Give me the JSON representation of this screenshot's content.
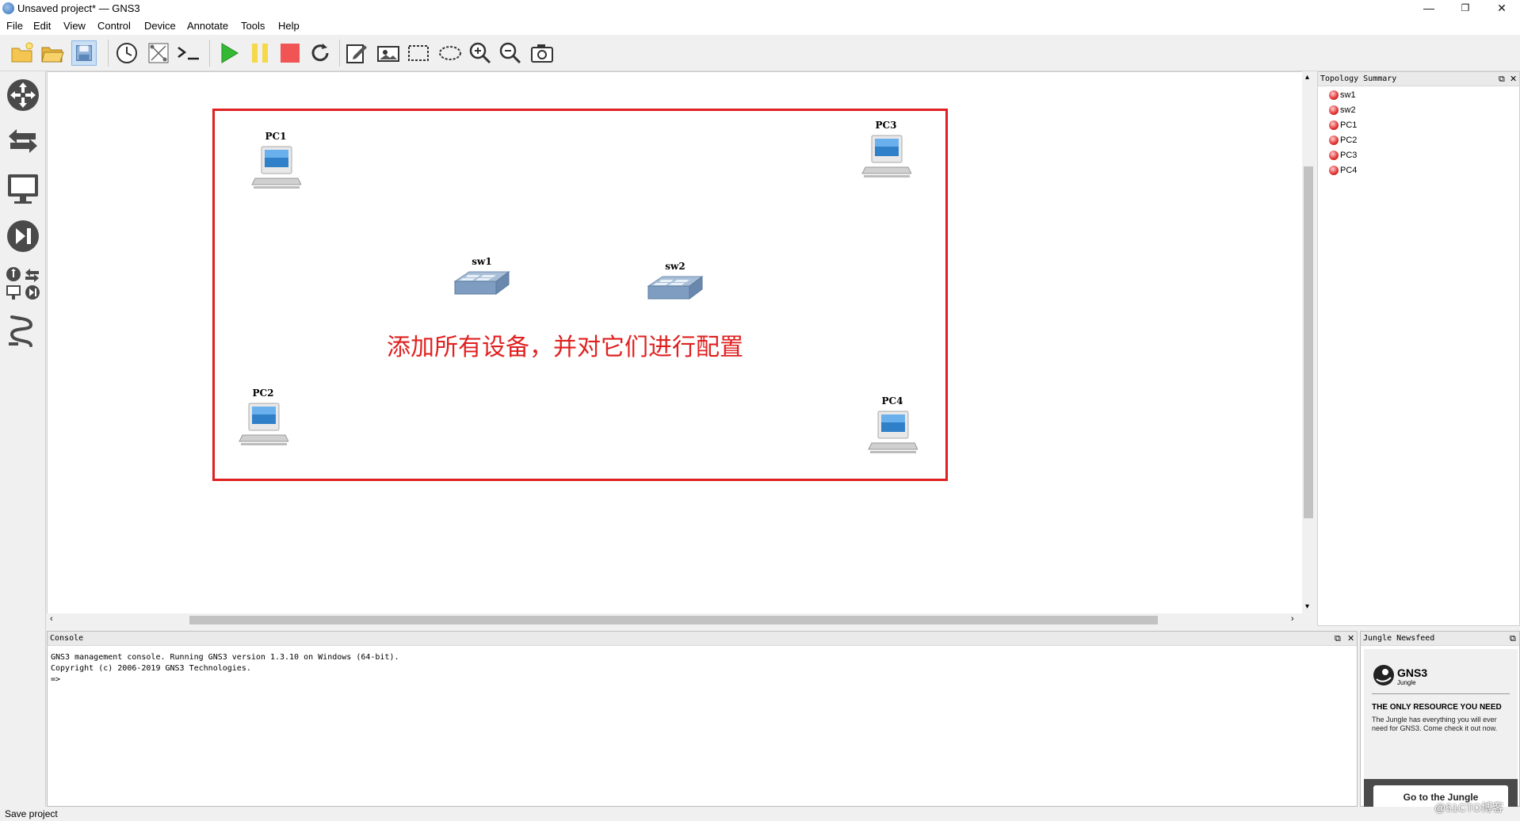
{
  "window": {
    "title": "Unsaved project* — GNS3"
  },
  "menu": [
    "File",
    "Edit",
    "View",
    "Control",
    "Device",
    "Annotate",
    "Tools",
    "Help"
  ],
  "canvas": {
    "devices": [
      {
        "label": "PC1",
        "kind": "pc"
      },
      {
        "label": "PC3",
        "kind": "pc"
      },
      {
        "label": "sw1",
        "kind": "switch"
      },
      {
        "label": "sw2",
        "kind": "switch"
      },
      {
        "label": "PC2",
        "kind": "pc"
      },
      {
        "label": "PC4",
        "kind": "pc"
      }
    ],
    "annotation": "添加所有设备，并对它们进行配置",
    "annotation_color": "#e02020"
  },
  "topology_summary": {
    "title": "Topology Summary",
    "items": [
      "sw1",
      "sw2",
      "PC1",
      "PC2",
      "PC3",
      "PC4"
    ]
  },
  "console": {
    "title": "Console",
    "lines": [
      "GNS3 management console. Running GNS3 version 1.3.10 on Windows (64-bit).",
      "Copyright (c) 2006-2019 GNS3 Technologies.",
      "",
      "=>"
    ]
  },
  "jungle": {
    "title": "Jungle Newsfeed",
    "logo_text": "GNS3",
    "logo_sub": "Jungle",
    "headline": "THE ONLY RESOURCE YOU NEED",
    "description": "The Jungle has everything you will ever need for GNS3. Come check it out now.",
    "button": "Go to the Jungle"
  },
  "status": "Save project",
  "watermark": "@51CTO博客"
}
